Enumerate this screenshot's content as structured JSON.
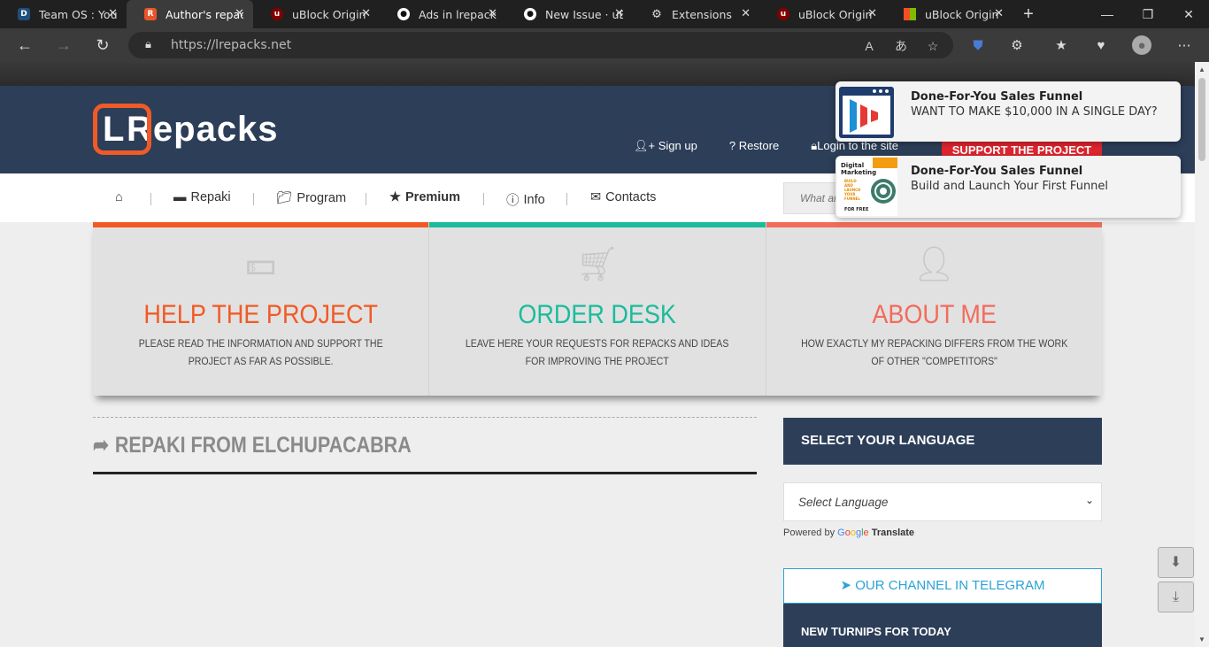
{
  "browser": {
    "tabs": [
      {
        "title": "Team OS : Your",
        "color": "#1f4f7a",
        "glyph": "D"
      },
      {
        "title": "Author's repack",
        "color": "#e8552b",
        "glyph": "R"
      },
      {
        "title": "uBlock Origin",
        "color": "#800000",
        "glyph": "uo"
      },
      {
        "title": "Ads in lrepacks",
        "color": "#111111",
        "glyph": "gh"
      },
      {
        "title": "New Issue · uB",
        "color": "#111111",
        "glyph": "gh"
      },
      {
        "title": "Extensions",
        "color": "#3b3b3b",
        "glyph": "puzzle"
      },
      {
        "title": "uBlock Origin",
        "color": "#800000",
        "glyph": "uo"
      },
      {
        "title": "uBlock Origin",
        "color": "#f25022",
        "glyph": "ms"
      }
    ],
    "active_tab_index": 1,
    "url": "https://lrepacks.net"
  },
  "site": {
    "logo_text": "Repacks",
    "logo_letter": "L",
    "header_links": {
      "signup": "Sign up",
      "restore": "Restore",
      "login": "Login to the site"
    },
    "support_label": "SUPPORT THE PROJECT",
    "menu": {
      "repaki": "Repaki",
      "program": "Program",
      "premium": "Premium",
      "info": "Info",
      "contacts": "Contacts"
    },
    "search_placeholder": "What are you looking for?",
    "cards": [
      {
        "title": "HELP THE PROJECT",
        "desc": "PLEASE READ THE INFORMATION AND SUPPORT THE PROJECT AS FAR AS POSSIBLE.",
        "color": "#f15a24"
      },
      {
        "title": "ORDER DESK",
        "desc": "LEAVE HERE YOUR REQUESTS FOR REPACKS AND IDEAS FOR IMPROVING THE PROJECT",
        "color": "#1abc9c"
      },
      {
        "title": "ABOUT ME",
        "desc": "HOW EXACTLY MY REPACKING DIFFERS FROM THE WORK OF OTHER \"COMPETITORS\"",
        "color": "#f26b5b"
      }
    ],
    "section_title": "REPAKI FROM ELCHUPACABRA",
    "language_heading": "SELECT YOUR LANGUAGE",
    "language_value": "Select Language",
    "powered_by": "Powered by",
    "google": "Google",
    "translate": "Translate",
    "telegram_label": "OUR CHANNEL IN TELEGRAM",
    "turnips_heading": "NEW TURNIPS FOR TODAY"
  },
  "notifications": [
    {
      "title": "Done-For-You Sales Funnel",
      "body": "WANT TO MAKE $10,000 IN A SINGLE DAY?"
    },
    {
      "title": "Done-For-You Sales Funnel",
      "body": "Build and Launch Your First Funnel",
      "image_text": [
        "Digital",
        "Marketing",
        "BUILD",
        "AND",
        "LAUNCH",
        "YOUR",
        "FUNNEL",
        "FOR FREE"
      ]
    }
  ]
}
